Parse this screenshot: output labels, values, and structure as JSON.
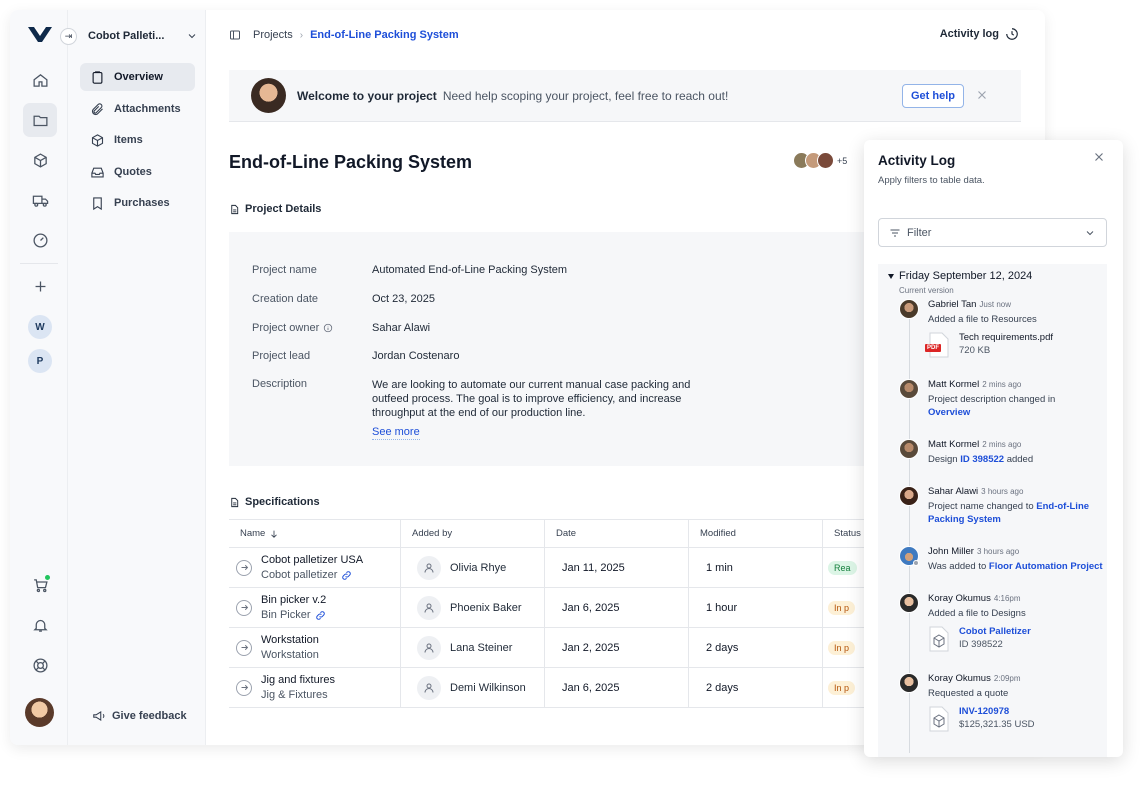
{
  "workspace": {
    "name": "Cobot Palleti...",
    "rail_letters": [
      "W",
      "P"
    ]
  },
  "nav": {
    "items": [
      {
        "label": "Overview",
        "icon": "clipboard-icon"
      },
      {
        "label": "Attachments",
        "icon": "paperclip-icon"
      },
      {
        "label": "Items",
        "icon": "cube-icon"
      },
      {
        "label": "Quotes",
        "icon": "inbox-icon"
      },
      {
        "label": "Purchases",
        "icon": "bookmark-icon"
      }
    ],
    "feedback": "Give feedback"
  },
  "breadcrumb": {
    "parent": "Projects",
    "current": "End-of-Line Packing System"
  },
  "activity_link": "Activity log",
  "welcome": {
    "title": "Welcome to your project",
    "text": "Need help scoping your project, feel free to reach out!",
    "help_button": "Get help"
  },
  "project": {
    "title": "End-of-Line Packing System",
    "members_more": "+5",
    "details_heading": "Project Details",
    "details": [
      {
        "key": "Project name",
        "value": "Automated End-of-Line Packing System"
      },
      {
        "key": "Creation date",
        "value": "Oct 23, 2025"
      },
      {
        "key": "Project owner",
        "value": "Sahar Alawi"
      },
      {
        "key": "Project lead",
        "value": "Jordan Costenaro"
      },
      {
        "key": "Description",
        "value": "We are looking to automate our current manual case packing and outfeed process. The goal is to improve efficiency, and increase throughput at the end of our production line."
      }
    ],
    "see_more": "See more"
  },
  "specs": {
    "heading": "Specifications",
    "columns": [
      "Name",
      "Added by",
      "Date",
      "Modified",
      "Status"
    ],
    "rows": [
      {
        "name": "Cobot palletizer USA",
        "sub": "Cobot palletizer",
        "linked": true,
        "added_by": "Olivia Rhye",
        "date": "Jan 11, 2025",
        "modified": "1 min",
        "status": "Rea"
      },
      {
        "name": "Bin picker v.2",
        "sub": "Bin Picker",
        "linked": true,
        "added_by": "Phoenix Baker",
        "date": "Jan 6, 2025",
        "modified": "1 hour",
        "status": "In p"
      },
      {
        "name": "Workstation",
        "sub": "Workstation",
        "linked": false,
        "added_by": "Lana Steiner",
        "date": "Jan 2, 2025",
        "modified": "2 days",
        "status": "In p"
      },
      {
        "name": "Jig and fixtures",
        "sub": "Jig & Fixtures",
        "linked": false,
        "added_by": "Demi Wilkinson",
        "date": "Jan 6, 2025",
        "modified": "2 days",
        "status": "In p"
      }
    ]
  },
  "activity": {
    "title": "Activity Log",
    "subtitle": "Apply filters to table data.",
    "filter_placeholder": "Filter",
    "day": "Friday September 12, 2024",
    "version": "Current version",
    "entries": [
      {
        "user": "Gabriel Tan",
        "time": "Just now",
        "text": "Added a file to Resources",
        "file_name": "Tech requirements.pdf",
        "file_meta": "720 KB"
      },
      {
        "user": "Matt Kormel",
        "time": "2 mins ago",
        "text": "Project description changed in",
        "link": "Overview"
      },
      {
        "user": "Matt Kormel",
        "time": "2 mins ago",
        "text_pre": "Design",
        "link": "ID 398522",
        "text_post": "added"
      },
      {
        "user": "Sahar Alawi",
        "time": "3 hours ago",
        "text": "Project name changed to",
        "link": "End-of-Line Packing System"
      },
      {
        "user": "John Miller",
        "time": "3 hours ago",
        "text": "Was added to",
        "link": "Floor Automation Project"
      },
      {
        "user": "Koray Okumus",
        "time": "4:16pm",
        "text": "Added a file to Designs",
        "file_name": "Cobot Palletizer",
        "file_meta": "ID 398522"
      },
      {
        "user": "Koray Okumus",
        "time": "2:09pm",
        "text": "Requested a quote",
        "file_name": "INV-120978",
        "file_meta": "$125,321.35 USD"
      }
    ]
  },
  "colors": {
    "accent": "#1d4ed8",
    "ready_green": "#15803d",
    "progress_amber": "#b45309"
  }
}
